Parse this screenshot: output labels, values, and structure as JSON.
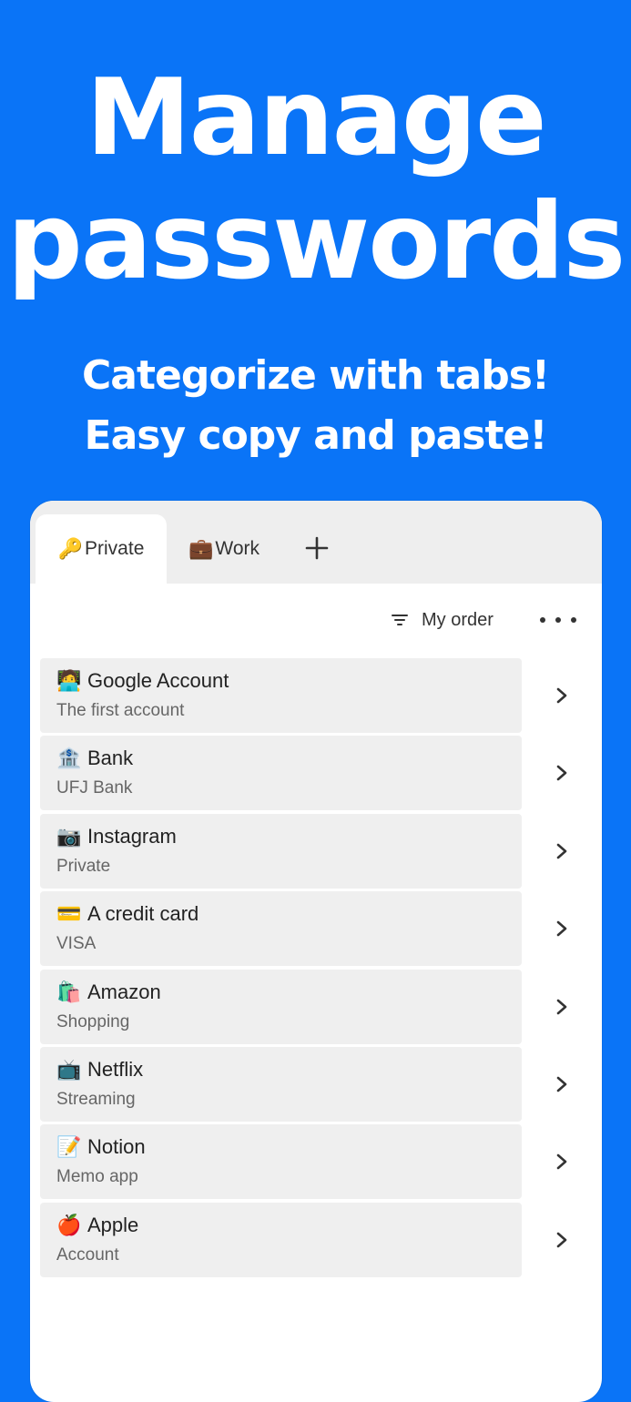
{
  "hero": {
    "title_line1": "Manage",
    "title_line2": "passwords",
    "subtitle_line1": "Categorize with tabs!",
    "subtitle_line2": "Easy copy and paste!"
  },
  "colors": {
    "background": "#0a74f7",
    "card": "#ffffff",
    "tabbar": "#eeeeee",
    "row": "#efefef"
  },
  "tabs": [
    {
      "icon": "🔑",
      "icon_name": "key-icon",
      "label": "Private",
      "active": true
    },
    {
      "icon": "💼",
      "icon_name": "briefcase-icon",
      "label": "Work",
      "active": false
    }
  ],
  "toolbar": {
    "sort_label": "My order",
    "sort_icon": "filter-icon",
    "more_icon": "more-horizontal-icon",
    "add_tab_icon": "plus-icon"
  },
  "items": [
    {
      "icon": "🧑‍💻",
      "icon_name": "technologist-icon",
      "title": "Google Account",
      "subtitle": "The first account"
    },
    {
      "icon": "🏦",
      "icon_name": "bank-icon",
      "title": "Bank",
      "subtitle": "UFJ Bank"
    },
    {
      "icon": "📷",
      "icon_name": "camera-icon",
      "title": "Instagram",
      "subtitle": "Private"
    },
    {
      "icon": "💳",
      "icon_name": "credit-card-icon",
      "title": "A credit card",
      "subtitle": "VISA"
    },
    {
      "icon": "🛍️",
      "icon_name": "shopping-bags-icon",
      "title": "Amazon",
      "subtitle": "Shopping"
    },
    {
      "icon": "📺",
      "icon_name": "television-icon",
      "title": "Netflix",
      "subtitle": "Streaming"
    },
    {
      "icon": "📝",
      "icon_name": "memo-icon",
      "title": "Notion",
      "subtitle": "Memo app"
    },
    {
      "icon": "🍎",
      "icon_name": "apple-icon",
      "title": "Apple",
      "subtitle": "Account"
    }
  ]
}
